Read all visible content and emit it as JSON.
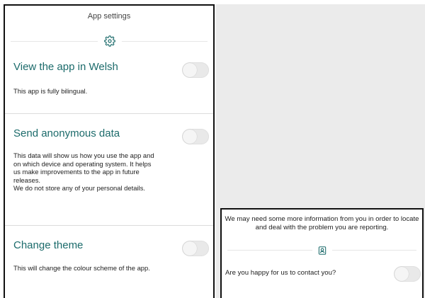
{
  "settings_screen": {
    "title": "App settings",
    "header_icon": "gear-icon",
    "items": [
      {
        "title": "View the app in Welsh",
        "description": "This app is fully bilingual.",
        "toggle_on": false
      },
      {
        "title": "Send anonymous data",
        "description": "This data will show us how you use the app and on which device and operating system. It helps us make improvements to the app in future releases.\nWe do not store any of your personal details.",
        "toggle_on": false
      },
      {
        "title": "Change theme",
        "description": "This will change the colour scheme of the app.",
        "toggle_on": false
      }
    ]
  },
  "contact_screen": {
    "intro": "We may need some more information from you in order to locate and deal with the problem you are reporting.",
    "header_icon": "contact-card-icon",
    "question": "Are you happy for us to contact you?",
    "toggle_on": false
  },
  "colors": {
    "accent": "#1c6b6b",
    "background_grey": "#ebebeb",
    "toggle_off": "#e9e9e9"
  }
}
